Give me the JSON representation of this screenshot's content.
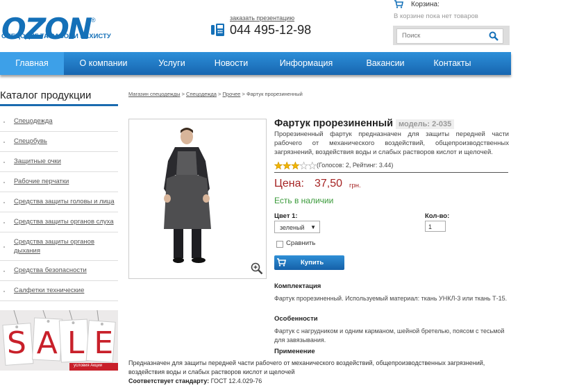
{
  "header": {
    "logo_text": "OZON",
    "logo_reg": "®",
    "logo_sub": "СПЕЦОДЯГ ТА ЗАСОБИ ЗАХИСТУ",
    "phone_link": "заказать презентацию",
    "phone": "044 495-12-98",
    "cart_title": "Корзина:",
    "cart_empty": "В корзине пока нет товаров",
    "search_placeholder": "Поиск"
  },
  "nav": {
    "items": [
      {
        "label": "Главная"
      },
      {
        "label": "О компании"
      },
      {
        "label": "Услуги"
      },
      {
        "label": "Новости"
      },
      {
        "label": "Информация"
      },
      {
        "label": "Вакансии"
      },
      {
        "label": "Контакты"
      }
    ]
  },
  "sidebar": {
    "title": "Каталог продукции",
    "items": [
      {
        "label": "Спецодежда"
      },
      {
        "label": "Спецобувь"
      },
      {
        "label": "Защитные очки"
      },
      {
        "label": "Рабочие перчатки"
      },
      {
        "label": "Средства защиты головы и лица"
      },
      {
        "label": "Средства защиты органов слуха"
      },
      {
        "label": "Средства защиты органов дыхания"
      },
      {
        "label": "Средства безопасности"
      },
      {
        "label": "Салфетки технические"
      }
    ],
    "sale_text": "SALE",
    "sale_caption": "условия Акции"
  },
  "breadcrumb": {
    "items": [
      "Магазин спецодежды",
      "Спецодежда",
      "Прочее"
    ],
    "sep": ">",
    "current": "Фартук прорезиненный"
  },
  "product": {
    "title": "Фартук прорезиненный",
    "model": "модель: 2-035",
    "description": "Прорезиненный фартук предназначен для защиты передней части рабочего от механического воздействий, общепроизводственных загрязнений, воздействия воды и слабых растворов кислот и щелочей.",
    "rating": 3,
    "rating_max": 5,
    "votes": "(Голосов: 2, Рейтинг: 3.44)",
    "price_label": "Цена:",
    "price": "37,50",
    "currency": "грн.",
    "stock": "Есть в наличии",
    "color_label": "Цвет 1:",
    "color_value": "зеленый",
    "qty_label": "Кол-во:",
    "qty_value": "1",
    "compare_label": "Сравнить",
    "buy_label": "Купить",
    "sections": [
      {
        "heading": "Комплектация",
        "text": "Фартук прорезиненный. Используемый материал: ткань УНКЛ-3 или ткань Т-15."
      },
      {
        "heading": "Особенности",
        "text": "Фартук с нагрудником и одним карманом, шейной бретелью, поясом с тесьмой для завязывания."
      },
      {
        "heading": "Применение",
        "text": ""
      }
    ],
    "usage_text": "Предназначен для защиты передней части рабочего от механического воздействий, общепроизводственных загрязнений, воздействия воды и слабых растворов кислот и щелочей",
    "standard_label": "Соответствует стандарту:",
    "standard_value": "ГОСТ 12.4.029-76"
  },
  "colors": {
    "brand": "#1470b8",
    "nav_top": "#2d8fd9",
    "nav_bottom": "#1766b0",
    "nav_active": "#3da0e8",
    "price": "#a52323",
    "stock": "#3a9a3a",
    "sale_red": "#c8202a"
  }
}
